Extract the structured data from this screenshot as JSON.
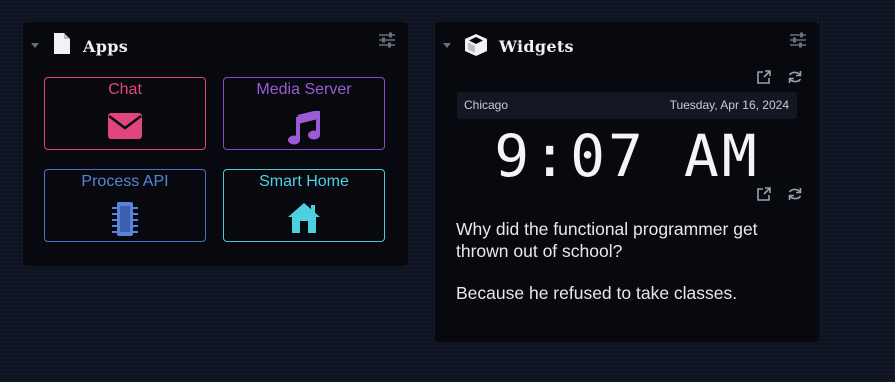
{
  "apps_panel": {
    "title": "Apps",
    "icons": {
      "header": "file-icon",
      "settings": "sliders-icon",
      "collapse": "caret-down-icon"
    },
    "tiles": [
      {
        "label": "Chat",
        "icon": "envelope-icon",
        "color": "#e0457b"
      },
      {
        "label": "Media Server",
        "icon": "music-note-icon",
        "color": "#9b5ad6"
      },
      {
        "label": "Process API",
        "icon": "chip-icon",
        "color": "#5a84d8"
      },
      {
        "label": "Smart Home",
        "icon": "home-icon",
        "color": "#4fd0e0"
      }
    ]
  },
  "widgets_panel": {
    "title": "Widgets",
    "icons": {
      "header": "cube-icon",
      "settings": "sliders-icon",
      "collapse": "caret-down-icon"
    },
    "clock_widget": {
      "location": "Chicago",
      "date": "Tuesday, Apr 16, 2024",
      "time": "9:07 AM",
      "icons": [
        "external-link-icon",
        "refresh-icon"
      ]
    },
    "joke_widget": {
      "question": "Why did the functional programmer get thrown out of school?",
      "answer": "Because he refused to take classes.",
      "icons": [
        "external-link-icon",
        "refresh-icon"
      ]
    }
  },
  "colors": {
    "background": "#0f1423",
    "panel": "#07090f",
    "text": "#eef0f4"
  }
}
